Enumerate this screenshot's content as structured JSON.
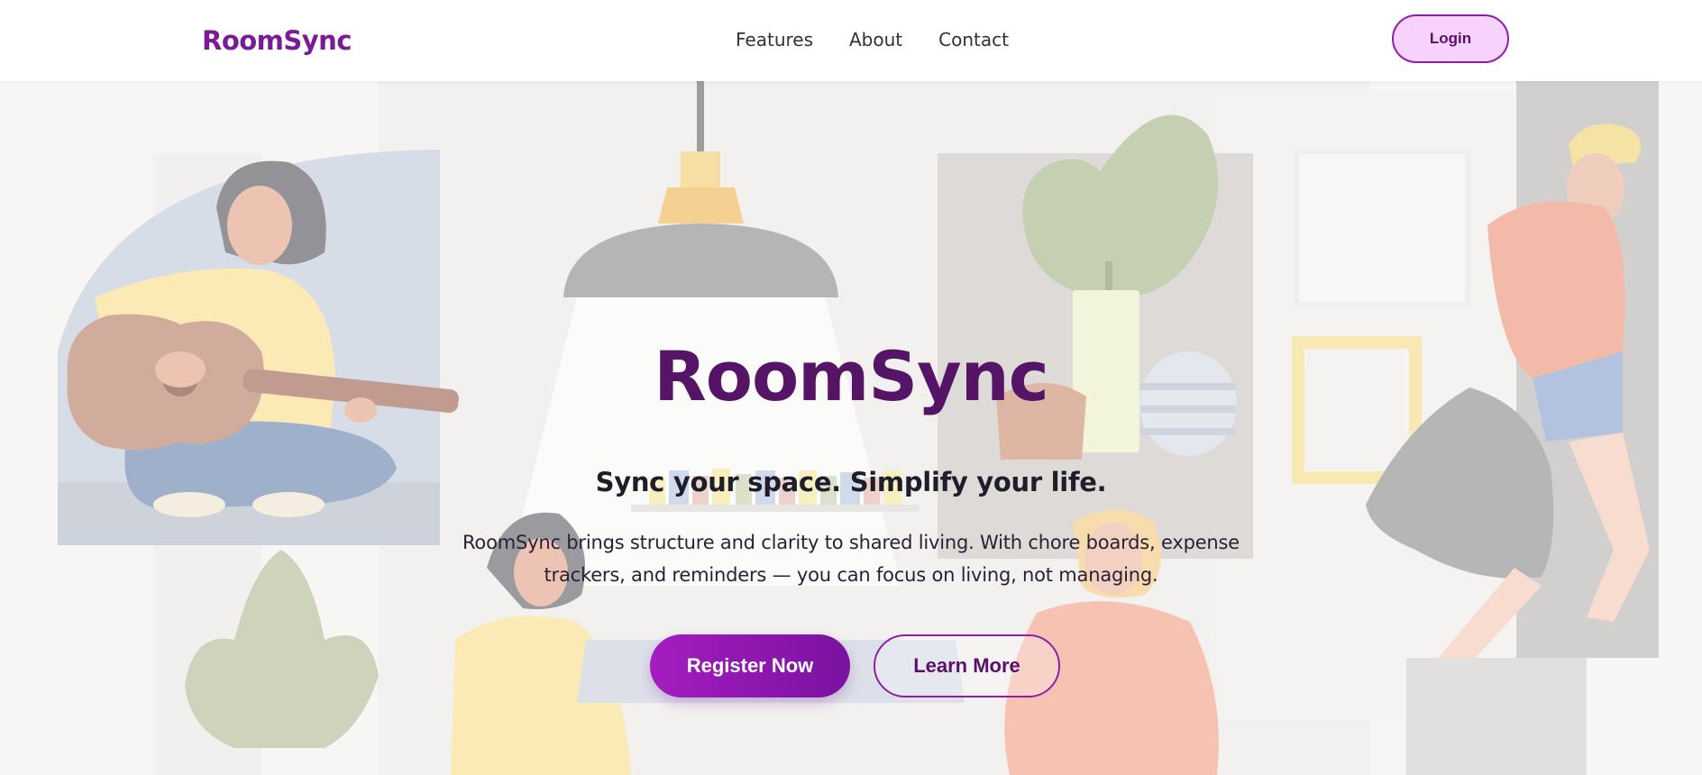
{
  "navbar": {
    "brand": "RoomSync",
    "links": [
      "Features",
      "About",
      "Contact"
    ],
    "login_label": "Login"
  },
  "hero": {
    "title": "RoomSync",
    "tagline": "Sync your space. Simplify your life.",
    "description": "RoomSync brings structure and clarity to shared living. With chore boards, expense trackers, and reminders — you can focus on living, not managing.",
    "register_label": "Register Now",
    "learn_label": "Learn More"
  },
  "colors": {
    "accent": "#8e1fa8",
    "title": "#561466",
    "login_bg": "#f7d2fb"
  }
}
